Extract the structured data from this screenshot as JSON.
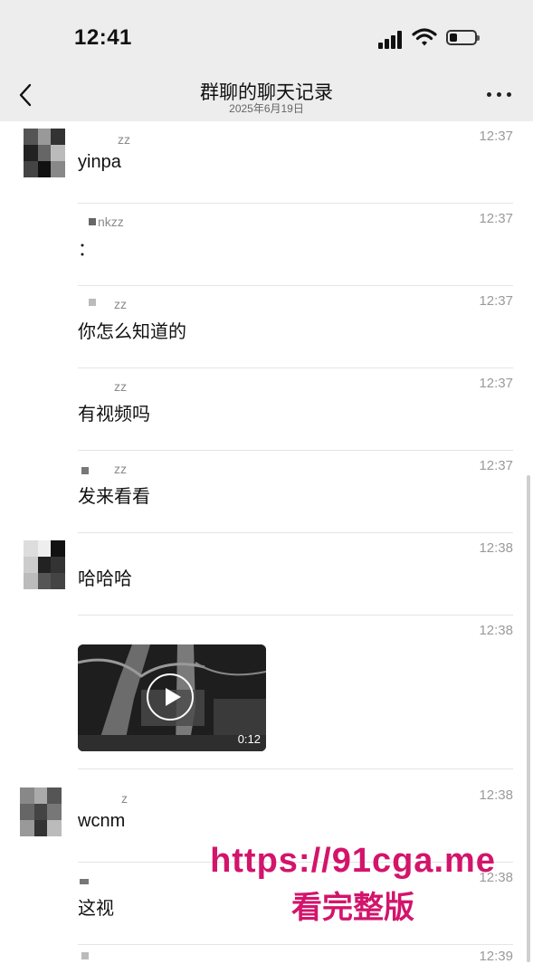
{
  "status_bar": {
    "time": "12:41"
  },
  "header": {
    "title": "群聊的聊天记录",
    "subtitle": "2025年6月19日"
  },
  "messages": [
    {
      "sender": "zz",
      "time": "12:37",
      "text": "yinpa"
    },
    {
      "sender": "nkzz",
      "time": "12:37",
      "text": "："
    },
    {
      "sender": "zz",
      "time": "12:37",
      "text": "你怎么知道的"
    },
    {
      "sender": "zz",
      "time": "12:37",
      "text": "有视频吗"
    },
    {
      "sender": "zz",
      "time": "12:37",
      "text": "发来看看"
    },
    {
      "sender": "",
      "time": "12:38",
      "text": "哈哈哈"
    },
    {
      "sender": "",
      "time": "12:38",
      "video_duration": "0:12"
    },
    {
      "sender": "z",
      "time": "12:38",
      "text": "wcnm"
    },
    {
      "sender": "",
      "time": "12:38",
      "text": "这视"
    },
    {
      "sender": "",
      "time": "12:39",
      "text": ""
    }
  ],
  "watermark": {
    "url": "https://91cga.me",
    "text": "看完整版"
  },
  "colors": {
    "watermark": "#d3146b",
    "nav_bg": "#ededed"
  }
}
